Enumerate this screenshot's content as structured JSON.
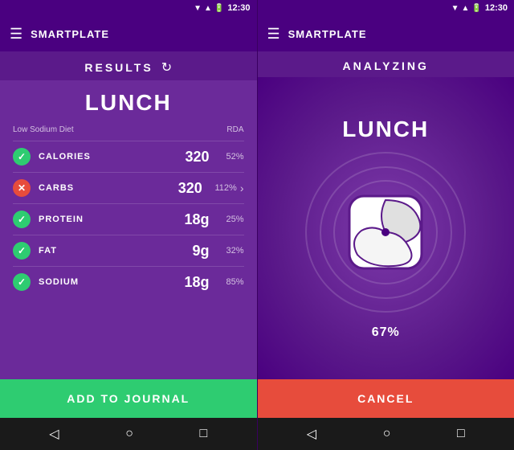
{
  "app": {
    "name": "SMARTPLATE",
    "time": "12:30"
  },
  "left_panel": {
    "header_title": "RESULTS",
    "meal_title": "LUNCH",
    "diet_label": "Low Sodium Diet",
    "rda_label": "RDA",
    "nutrients": [
      {
        "name": "CALORIES",
        "value": "320",
        "rda": "52%",
        "icon": "check",
        "status": "green",
        "has_arrow": false
      },
      {
        "name": "CARBS",
        "value": "320",
        "rda": "112%",
        "icon": "x",
        "status": "red",
        "has_arrow": true
      },
      {
        "name": "PROTEIN",
        "value": "18g",
        "rda": "25%",
        "icon": "check",
        "status": "green",
        "has_arrow": false
      },
      {
        "name": "FAT",
        "value": "9g",
        "rda": "32%",
        "icon": "check",
        "status": "green",
        "has_arrow": false
      },
      {
        "name": "SODIUM",
        "value": "18g",
        "rda": "85%",
        "icon": "check",
        "status": "green",
        "has_arrow": false
      }
    ],
    "add_btn_label": "ADD TO JOURNAL"
  },
  "right_panel": {
    "header_title": "ANALYZING",
    "meal_title": "LUNCH",
    "progress_percent": "67%",
    "cancel_btn_label": "CANCEL"
  },
  "nav": {
    "back_icon": "◁",
    "home_icon": "○",
    "recents_icon": "□"
  }
}
